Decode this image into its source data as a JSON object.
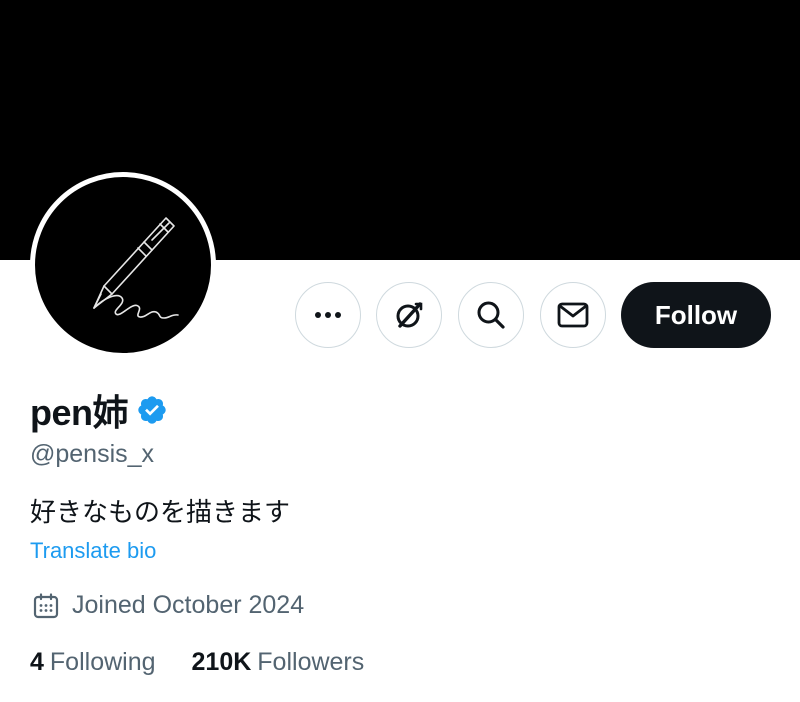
{
  "profile": {
    "display_name": "pen姉",
    "handle": "@pensis_x",
    "bio": "好きなものを描きます",
    "translate_label": "Translate bio",
    "joined": "Joined October 2024"
  },
  "actions": {
    "more_icon": "more-horizontal-icon",
    "grok_icon": "grok-icon",
    "search_icon": "search-icon",
    "message_icon": "mail-icon",
    "follow_label": "Follow"
  },
  "stats": {
    "following_count": "4",
    "following_label": "Following",
    "followers_count": "210K",
    "followers_label": "Followers"
  },
  "colors": {
    "banner": "#000000",
    "text_primary": "#0f1419",
    "text_secondary": "#536471",
    "link": "#1d9bf0",
    "verified": "#1d9bf0",
    "button_border": "#cfd9de"
  }
}
